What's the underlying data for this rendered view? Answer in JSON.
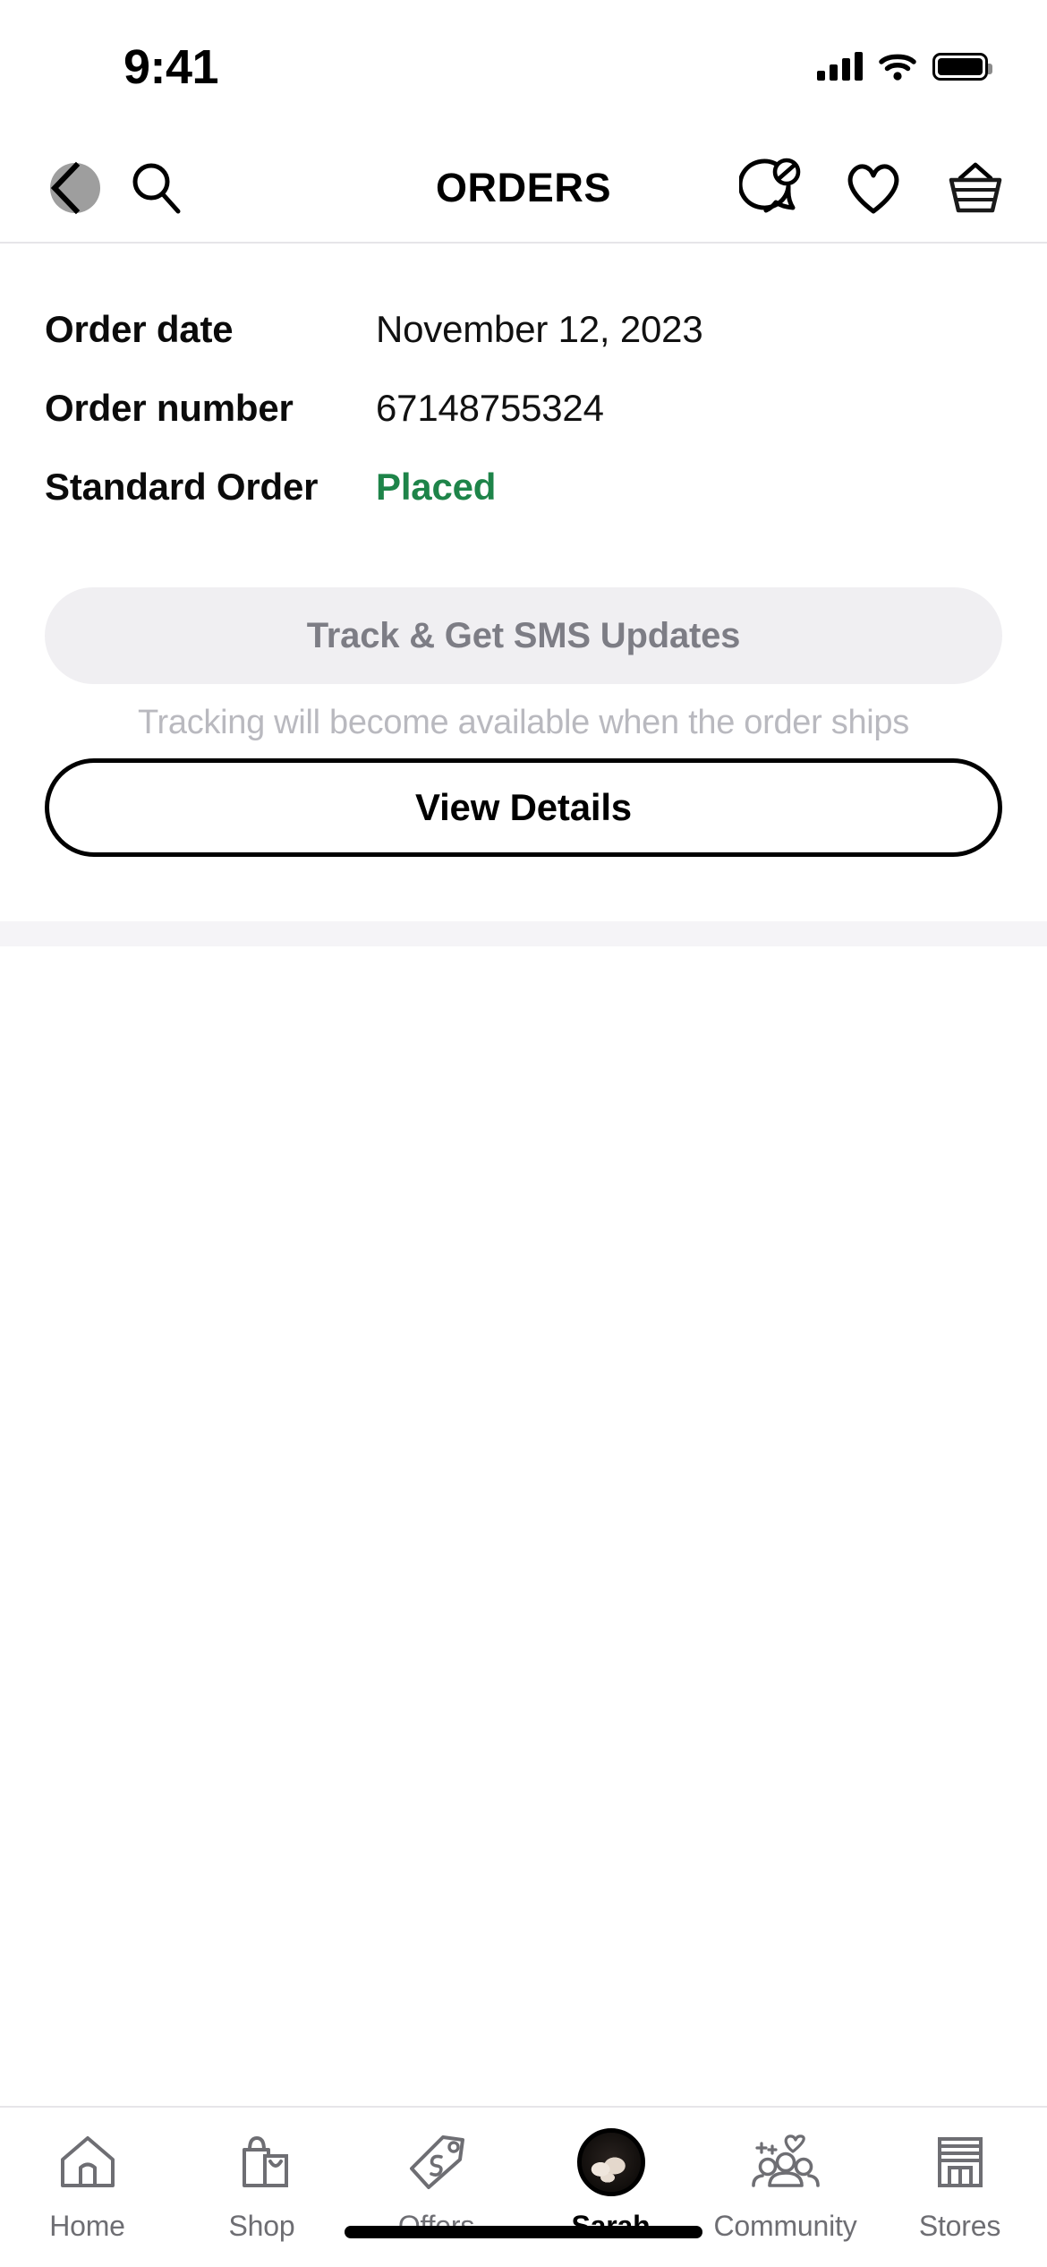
{
  "status_bar": {
    "time": "9:41",
    "signal_icon": "cellular-signal-icon",
    "wifi_icon": "wifi-icon",
    "battery_icon": "battery-icon"
  },
  "header": {
    "title": "ORDERS",
    "back_icon": "back-chevron-icon",
    "search_icon": "search-icon",
    "messages_icon": "chat-bubble-muted-icon",
    "favorites_icon": "heart-icon",
    "basket_icon": "shopping-basket-icon"
  },
  "order": {
    "rows": [
      {
        "label": "Order date",
        "value": "November 12, 2023",
        "is_status": false
      },
      {
        "label": "Order number",
        "value": "67148755324",
        "is_status": false
      },
      {
        "label": "Standard Order",
        "value": "Placed",
        "is_status": true
      }
    ],
    "status_color": "#1e8449"
  },
  "actions": {
    "track_button": "Track & Get SMS Updates",
    "track_note": "Tracking will become available when the order ships",
    "details_button": "View Details"
  },
  "tabbar": {
    "items": [
      {
        "label": "Home",
        "icon": "home-icon",
        "active": false
      },
      {
        "label": "Shop",
        "icon": "shopping-bag-icon",
        "active": false
      },
      {
        "label": "Offers",
        "icon": "price-tag-icon",
        "active": false
      },
      {
        "label": "Sarah",
        "icon": "avatar-icon",
        "active": true
      },
      {
        "label": "Community",
        "icon": "community-people-icon",
        "active": false
      },
      {
        "label": "Stores",
        "icon": "store-building-icon",
        "active": false
      }
    ]
  }
}
